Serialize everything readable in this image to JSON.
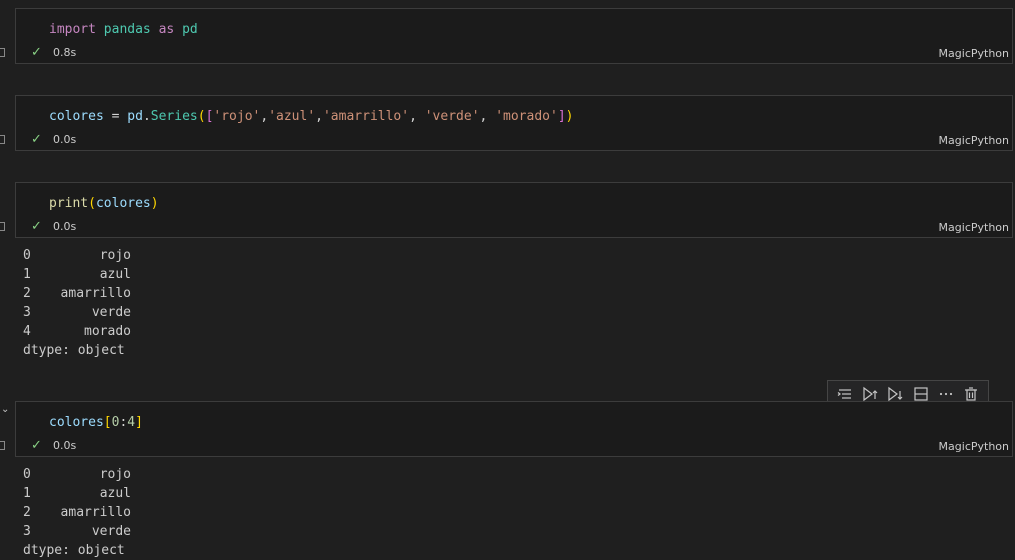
{
  "cells": [
    {
      "code_tokens": [
        {
          "t": "import",
          "c": "kw"
        },
        {
          "t": " ",
          "c": "pl"
        },
        {
          "t": "pandas",
          "c": "mod"
        },
        {
          "t": " ",
          "c": "pl"
        },
        {
          "t": "as",
          "c": "kw"
        },
        {
          "t": " ",
          "c": "pl"
        },
        {
          "t": "pd",
          "c": "mod"
        }
      ],
      "time": "0.8s",
      "lang": "MagicPython"
    },
    {
      "code_tokens": [
        {
          "t": "colores",
          "c": "var"
        },
        {
          "t": " = ",
          "c": "pl"
        },
        {
          "t": "pd",
          "c": "var"
        },
        {
          "t": ".",
          "c": "pl"
        },
        {
          "t": "Series",
          "c": "mod"
        },
        {
          "t": "(",
          "c": "br1"
        },
        {
          "t": "[",
          "c": "br2"
        },
        {
          "t": "'rojo'",
          "c": "str"
        },
        {
          "t": ",",
          "c": "pl"
        },
        {
          "t": "'azul'",
          "c": "str"
        },
        {
          "t": ",",
          "c": "pl"
        },
        {
          "t": "'amarrillo'",
          "c": "str"
        },
        {
          "t": ", ",
          "c": "pl"
        },
        {
          "t": "'verde'",
          "c": "str"
        },
        {
          "t": ", ",
          "c": "pl"
        },
        {
          "t": "'morado'",
          "c": "str"
        },
        {
          "t": "]",
          "c": "br2"
        },
        {
          "t": ")",
          "c": "br1"
        }
      ],
      "time": "0.0s",
      "lang": "MagicPython"
    },
    {
      "code_tokens": [
        {
          "t": "print",
          "c": "fn"
        },
        {
          "t": "(",
          "c": "br1"
        },
        {
          "t": "colores",
          "c": "var"
        },
        {
          "t": ")",
          "c": "br1"
        }
      ],
      "time": "0.0s",
      "lang": "MagicPython",
      "output": {
        "rows": [
          {
            "idx": "0",
            "val": "rojo"
          },
          {
            "idx": "1",
            "val": "azul"
          },
          {
            "idx": "2",
            "val": "amarrillo"
          },
          {
            "idx": "3",
            "val": "verde"
          },
          {
            "idx": "4",
            "val": "morado"
          }
        ],
        "dtype": "dtype: object"
      }
    },
    {
      "code_tokens": [
        {
          "t": "colores",
          "c": "var"
        },
        {
          "t": "[",
          "c": "br1"
        },
        {
          "t": "0",
          "c": "num"
        },
        {
          "t": ":",
          "c": "pl"
        },
        {
          "t": "4",
          "c": "num"
        },
        {
          "t": "]",
          "c": "br1"
        }
      ],
      "time": "0.0s",
      "lang": "MagicPython",
      "output": {
        "rows": [
          {
            "idx": "0",
            "val": "rojo"
          },
          {
            "idx": "1",
            "val": "azul"
          },
          {
            "idx": "2",
            "val": "amarrillo"
          },
          {
            "idx": "3",
            "val": "verde"
          }
        ],
        "dtype": "dtype: object"
      }
    }
  ],
  "toolbar": {
    "icons": [
      "run-by-line-icon",
      "execute-above-icon",
      "execute-below-icon",
      "split-cell-icon",
      "more-actions-icon",
      "delete-icon"
    ]
  },
  "colors": {
    "success": "#89d185",
    "background": "#1f1f1f",
    "cell_border": "#3c3c3c"
  }
}
